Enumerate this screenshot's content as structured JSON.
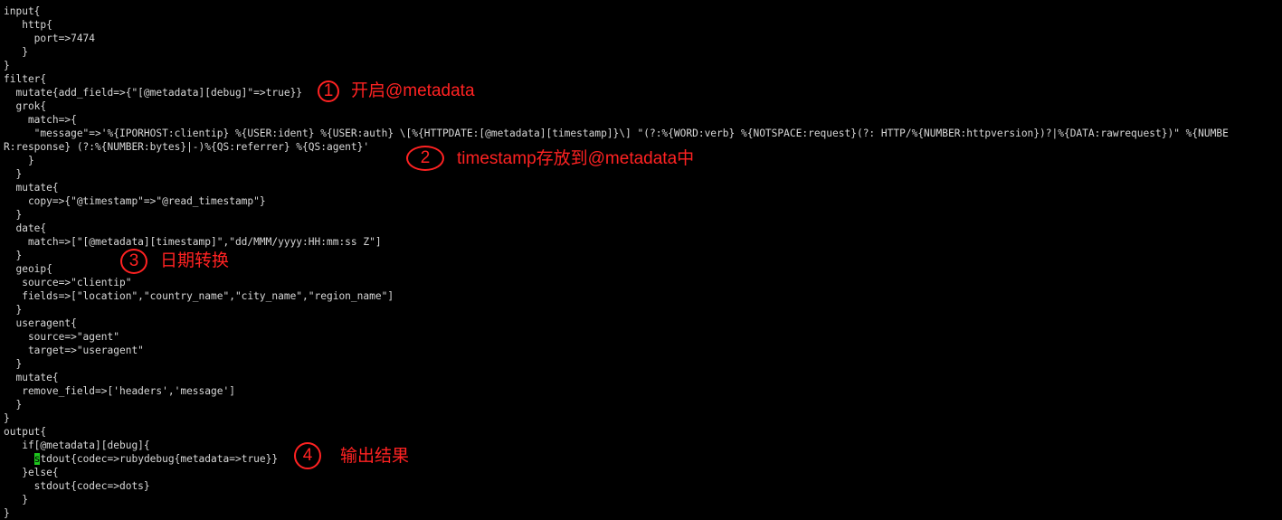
{
  "code_lines": [
    "input{",
    "   http{",
    "     port=>7474",
    "   }",
    "}",
    "filter{",
    "  mutate{add_field=>{\"[@metadata][debug]\"=>true}}",
    "  grok{",
    "    match=>{",
    "     \"message\"=>'%{IPORHOST:clientip} %{USER:ident} %{USER:auth} \\[%{HTTPDATE:[@metadata][timestamp]}\\] \"(?:%{WORD:verb} %{NOTSPACE:request}(?: HTTP/%{NUMBER:httpversion})?|%{DATA:rawrequest})\" %{NUMBE",
    "R:response} (?:%{NUMBER:bytes}|-)%{QS:referrer} %{QS:agent}'",
    "    }",
    "  }",
    "  mutate{",
    "    copy=>{\"@timestamp\"=>\"@read_timestamp\"}",
    "  }",
    "  date{",
    "    match=>[\"[@metadata][timestamp]\",\"dd/MMM/yyyy:HH:mm:ss Z\"]",
    "  }",
    "  geoip{",
    "   source=>\"clientip\"",
    "   fields=>[\"location\",\"country_name\",\"city_name\",\"region_name\"]",
    "  }",
    "  useragent{",
    "    source=>\"agent\"",
    "    target=>\"useragent\"",
    "  }",
    "  mutate{",
    "   remove_field=>['headers','message']",
    "  }",
    "}",
    "output{",
    "   if[@metadata][debug]{",
    "     stdout{codec=>rubydebug{metadata=>true}}",
    "   }else{",
    "     stdout{codec=>dots}",
    "   }",
    "}"
  ],
  "cursor_char": "s",
  "cursor_line_rest": "tdout{codec=>rubydebug{metadata=>true}}",
  "cursor_line_indent": "     ",
  "annotations": [
    {
      "number": "1",
      "text": "开启@metadata"
    },
    {
      "number": "2",
      "text": "timestamp存放到@metadata中"
    },
    {
      "number": "3",
      "text": "日期转换"
    },
    {
      "number": "4",
      "text": "输出结果"
    }
  ],
  "colors": {
    "background": "#000000",
    "code_text": "#d8d8d8",
    "annotation": "#ff2222",
    "cursor": "#1ec71e"
  }
}
